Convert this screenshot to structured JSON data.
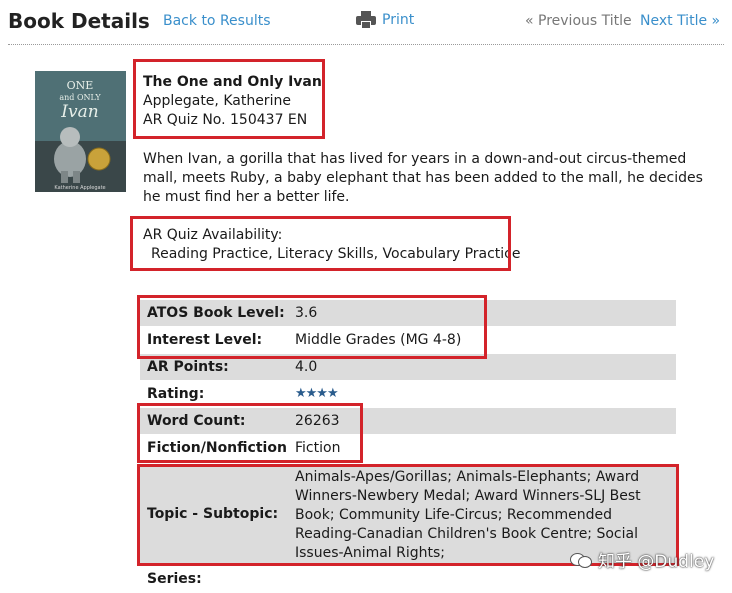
{
  "header": {
    "page_title": "Book Details",
    "back_link": "Back to Results",
    "print_label": "Print",
    "previous_title": "« Previous Title",
    "next_title": "Next Title »"
  },
  "cover": {
    "title_line1": "ONE",
    "title_line2": "and ONLY",
    "title_line3": "Ivan",
    "author": "Katherine Applegate"
  },
  "book": {
    "title": "The One and Only Ivan",
    "author": "Applegate, Katherine",
    "quiz_number": "AR Quiz No. 150437 EN",
    "description": "When Ivan, a gorilla that has lived for years in a down-and-out circus-themed mall, meets Ruby, a baby elephant that has been added to the mall, he decides he must find her a better life.",
    "availability_label": "AR Quiz Availability:",
    "availability_value": "Reading Practice, Literacy Skills, Vocabulary Practice"
  },
  "details": {
    "atos_label": "ATOS Book Level:",
    "atos_value": "3.6",
    "interest_label": "Interest Level:",
    "interest_value": "Middle Grades (MG 4-8)",
    "points_label": "AR Points:",
    "points_value": "4.0",
    "rating_label": "Rating:",
    "rating_stars": 3.5,
    "rating_glyphs": "★★★★",
    "word_count_label": "Word Count:",
    "word_count_value": "26263",
    "fiction_label": "Fiction/Nonfiction",
    "fiction_value": "Fiction",
    "topic_label": "Topic - Subtopic:",
    "topic_value": "Animals-Apes/Gorillas; Animals-Elephants; Award Winners-Newbery Medal; Award Winners-SLJ Best Book; Community Life-Circus; Recommended Reading-Canadian Children's Book Centre; Social Issues-Animal Rights;",
    "series_label": "Series:"
  },
  "watermark": {
    "text": "知乎 @Dudley"
  },
  "colors": {
    "link": "#3a8fcb",
    "highlight_border": "#d3232a",
    "row_shade": "#dcdcdc",
    "star": "#2a5c8d"
  }
}
